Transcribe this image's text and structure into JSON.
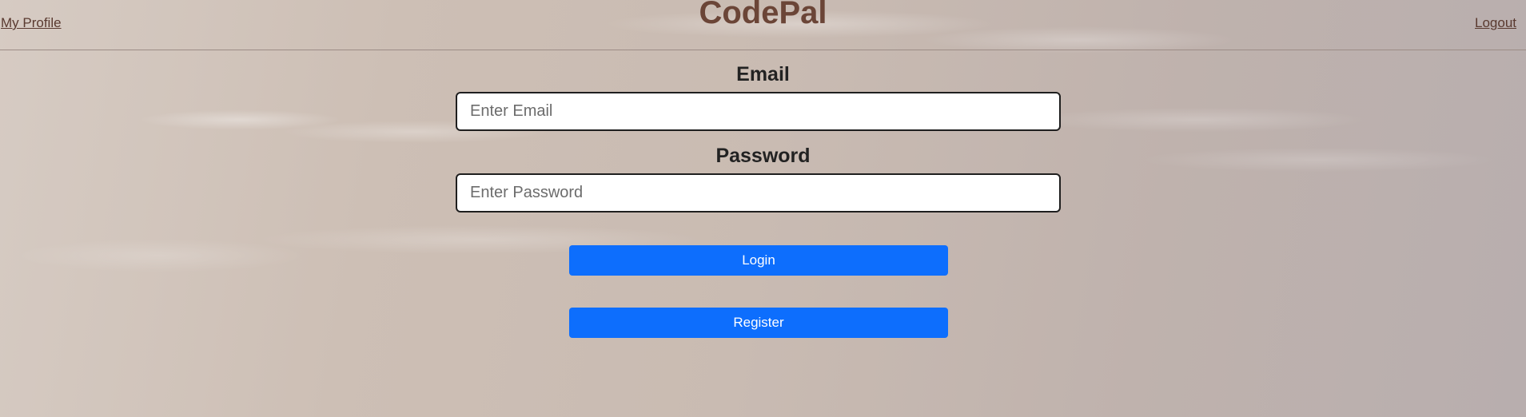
{
  "header": {
    "profile_link": "My Profile",
    "brand": "CodePal",
    "logout_link": "Logout"
  },
  "form": {
    "email_label": "Email",
    "email_placeholder": "Enter Email",
    "password_label": "Password",
    "password_placeholder": "Enter Password",
    "login_label": "Login",
    "register_label": "Register"
  },
  "colors": {
    "brand": "#6b4537",
    "link": "#5a3a30",
    "button": "#0d6efd"
  }
}
